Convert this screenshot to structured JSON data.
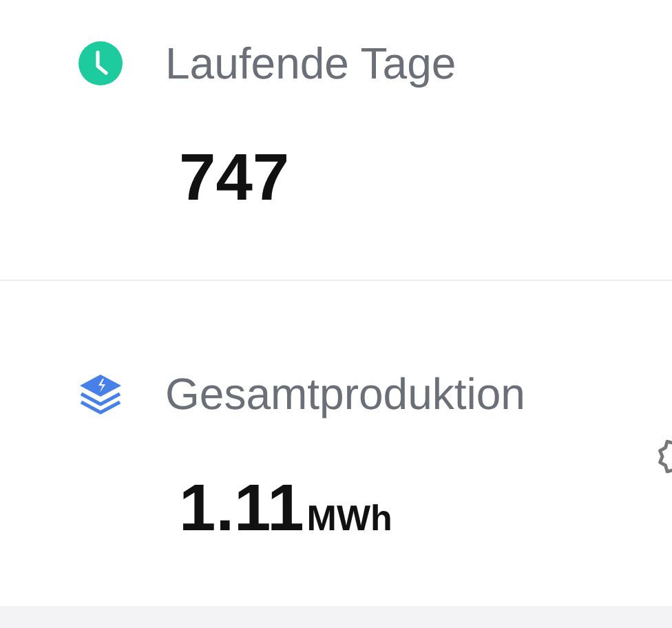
{
  "stats": [
    {
      "kind": "days",
      "label": "Laufende Tage",
      "value": "747"
    },
    {
      "kind": "production",
      "label": "Gesamtproduktion",
      "value": "1.11",
      "unit": "MWh"
    }
  ]
}
